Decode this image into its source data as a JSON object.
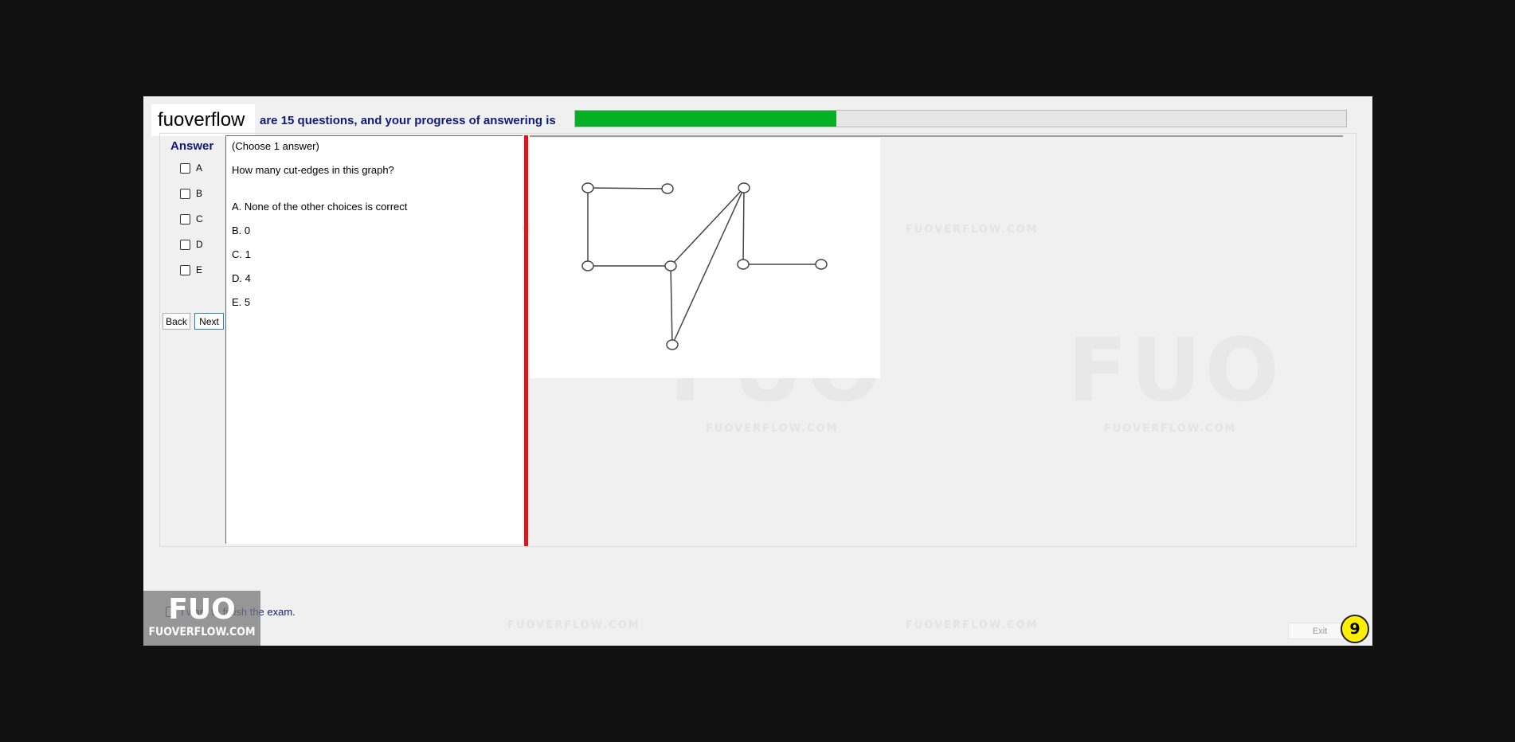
{
  "brand": "fuoverflow",
  "progress": {
    "text": "are 15 questions, and your progress of answering is",
    "fraction": 0.339,
    "fill_color": "#06b025"
  },
  "answer": {
    "title": "Answer",
    "options": [
      "A",
      "B",
      "C",
      "D",
      "E"
    ]
  },
  "nav": {
    "back": "Back",
    "next": "Next"
  },
  "question": {
    "instruction": "(Choose 1 answer)",
    "prompt": "How many cut-edges in this graph?",
    "choices": [
      "A.  None of the other choices is correct",
      "B.  0",
      "C.  1",
      "D.  4",
      "E.  5"
    ]
  },
  "finish": {
    "label": "I want to finish the exam."
  },
  "logo": {
    "line1": "FUO",
    "line2": "FUOVERFLOW.COM"
  },
  "watermark": {
    "text": "FUOVERFLOW.COM",
    "big": "FUO"
  },
  "exit": "Exit",
  "page_number": "9",
  "colors": {
    "accent_text": "#101a7a",
    "splitter": "#d8181d",
    "badge": "#ffee00"
  }
}
